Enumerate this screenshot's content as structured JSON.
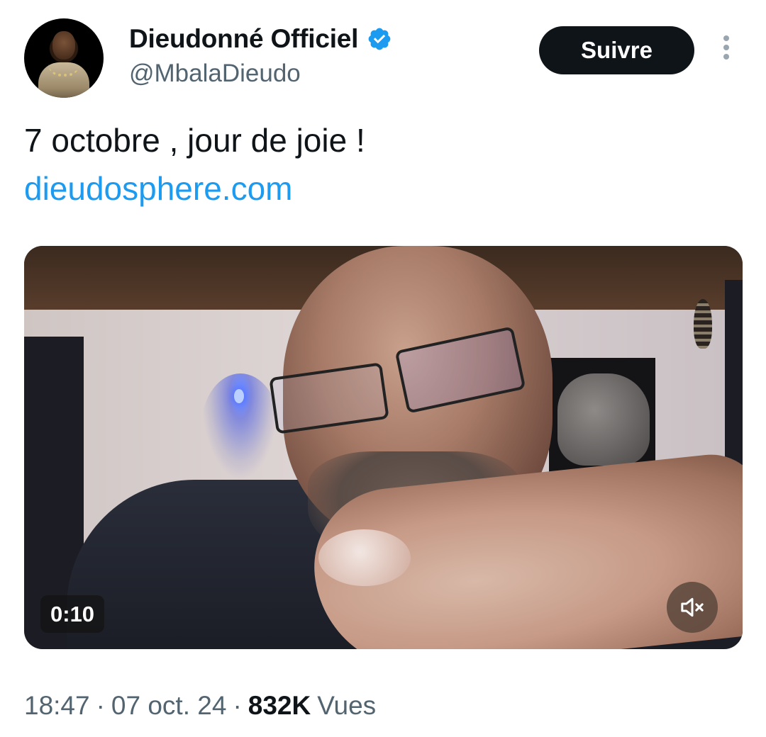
{
  "author": {
    "display_name": "Dieudonné Officiel",
    "handle": "@MbalaDieudo",
    "verified": true,
    "verified_color": "#1d9bf0"
  },
  "actions": {
    "follow_label": "Suivre"
  },
  "tweet": {
    "text": "7 octobre , jour de joie !",
    "link": "dieudosphere.com",
    "link_color": "#1d9bf0"
  },
  "video": {
    "duration": "0:10",
    "muted": true
  },
  "meta": {
    "time": "18:47",
    "separator": "·",
    "date": "07 oct. 24",
    "views_count": "832K",
    "views_label": "Vues"
  }
}
